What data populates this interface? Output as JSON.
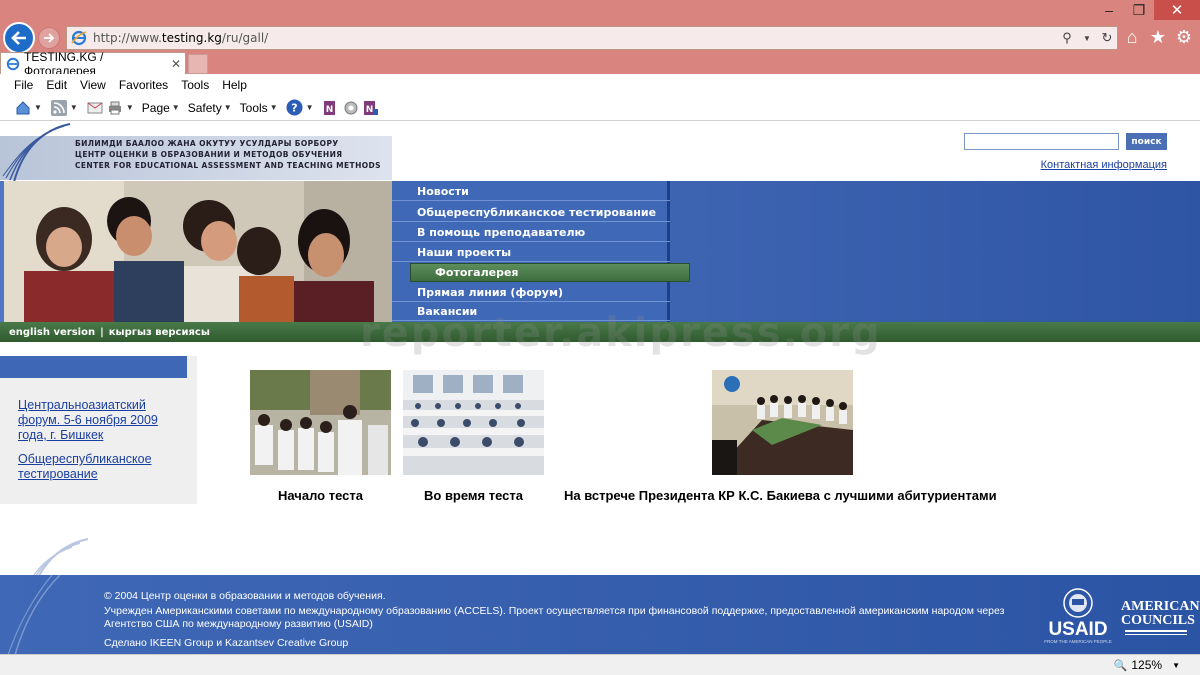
{
  "browser": {
    "url_prefix": "http://www.",
    "url_domain": "testing.kg",
    "url_path": "/ru/gall/",
    "tab_title": "TESTING.KG / Фотогалерея",
    "menu": [
      "File",
      "Edit",
      "View",
      "Favorites",
      "Tools",
      "Help"
    ],
    "cmd_page": "Page",
    "cmd_safety": "Safety",
    "cmd_tools": "Tools",
    "zoom": "125%"
  },
  "header": {
    "logo_lines": [
      "БИЛИМДИ БААЛОО ЖАНА ОКУТУУ УСУЛДАРЫ БОРБОРУ",
      "ЦЕНТР ОЦЕНКИ В ОБРАЗОВАНИИ И  МЕТОДОВ ОБУЧЕНИЯ",
      "CENTER FOR EDUCATIONAL ASSESSMENT AND TEACHING METHODS"
    ],
    "search_button": "поиск",
    "contact_link": "Контактная информация"
  },
  "nav": {
    "items": [
      "Новости",
      "Общереспубликанское тестирование",
      "В помощь преподавателю",
      "Наши проекты",
      "Фотогалерея",
      "Прямая линия (форум)",
      "Вакансии"
    ],
    "active_index": 4
  },
  "lang": {
    "english": "english version",
    "separator": "|",
    "kyrgyz": "кыргыз версиясы"
  },
  "watermark": "reporter.akipress.org",
  "sidebar": {
    "links": [
      "Центральноазиатский форум. 5-6 ноября 2009 года, г. Бишкек",
      "Общереспубликанское тестирование"
    ]
  },
  "gallery": [
    {
      "caption": "Начало теста"
    },
    {
      "caption": "Во время теста"
    },
    {
      "caption": "На встрече Президента КР К.С. Бакиева с лучшими абитуриентами"
    }
  ],
  "footer": {
    "copyright": "© 2004 Центр оценки в образовании и методов обучения.",
    "founded": "Учрежден Американскими советами по международному образованию (ACCELS). Проект осуществляется при финансовой поддержке, предоставленной американским народом через Агентство США по международному развитию (USAID)",
    "credits": "Сделано IKEEN Group и Kazantsev Creative Group",
    "usaid_label": "USAID",
    "usaid_sub": "FROM THE AMERICAN PEOPLE",
    "councils_line1": "AMERICAN",
    "councils_line2": "COUNCILS"
  }
}
